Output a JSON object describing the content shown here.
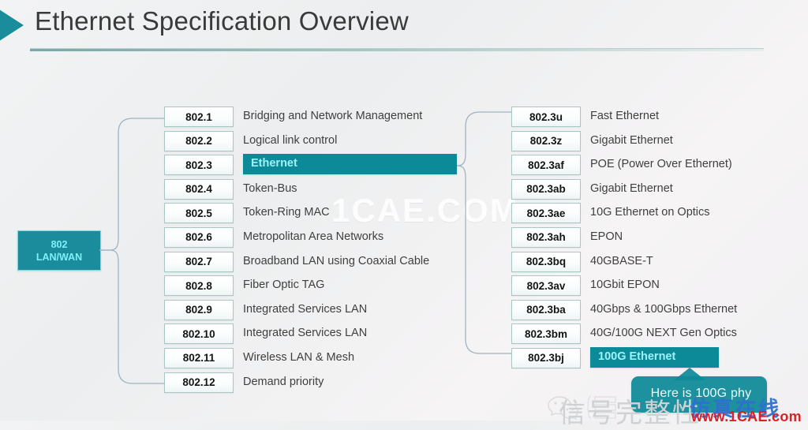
{
  "header": {
    "title": "Ethernet Specification Overview",
    "arrow_icon": "triangle-right-icon"
  },
  "root_node": {
    "line1": "802",
    "line2": "LAN/WAN",
    "color": "#1b8c9b"
  },
  "colors": {
    "accent": "#1b8c9b",
    "highlight_bg": "#0d8a98",
    "highlight_text": "#9ef2fa",
    "box_border": "#a9c6c5",
    "text": "#3f3f3f",
    "callout_bg": "#0e8a98"
  },
  "left_column": [
    {
      "code": "802.1",
      "desc": "Bridging and Network Management",
      "highlight": false
    },
    {
      "code": "802.2",
      "desc": "Logical link control",
      "highlight": false
    },
    {
      "code": "802.3",
      "desc": "Ethernet",
      "highlight": true
    },
    {
      "code": "802.4",
      "desc": "Token-Bus",
      "highlight": false
    },
    {
      "code": "802.5",
      "desc": "Token-Ring MAC",
      "highlight": false
    },
    {
      "code": "802.6",
      "desc": "Metropolitan Area Networks",
      "highlight": false
    },
    {
      "code": "802.7",
      "desc": "Broadband LAN using Coaxial Cable",
      "highlight": false
    },
    {
      "code": "802.8",
      "desc": "Fiber Optic TAG",
      "highlight": false
    },
    {
      "code": "802.9",
      "desc": "Integrated Services LAN",
      "highlight": false
    },
    {
      "code": "802.10",
      "desc": "Integrated Services LAN",
      "highlight": false
    },
    {
      "code": "802.11",
      "desc": "Wireless LAN & Mesh",
      "highlight": false
    },
    {
      "code": "802.12",
      "desc": "Demand priority",
      "highlight": false
    }
  ],
  "right_column": [
    {
      "code": "802.3u",
      "desc": "Fast Ethernet",
      "highlight": false
    },
    {
      "code": "802.3z",
      "desc": "Gigabit Ethernet",
      "highlight": false
    },
    {
      "code": "802.3af",
      "desc": "POE (Power Over Ethernet)",
      "highlight": false
    },
    {
      "code": "802.3ab",
      "desc": "Gigabit Ethernet",
      "highlight": false
    },
    {
      "code": "802.3ae",
      "desc": "10G Ethernet on Optics",
      "highlight": false
    },
    {
      "code": "802.3ah",
      "desc": "EPON",
      "highlight": false
    },
    {
      "code": "802.3bq",
      "desc": "40GBASE-T",
      "highlight": false
    },
    {
      "code": "802.3av",
      "desc": "10Gbit EPON",
      "highlight": false
    },
    {
      "code": "802.3ba",
      "desc": "40Gbps & 100Gbps Ethernet",
      "highlight": false
    },
    {
      "code": "802.3bm",
      "desc": "40G/100G NEXT Gen Optics",
      "highlight": false
    },
    {
      "code": "802.3bj",
      "desc": "100G Ethernet",
      "highlight": true
    }
  ],
  "callout": {
    "text": "Here is 100G phy"
  },
  "watermarks": {
    "center": "1CAE.COM",
    "bottom_cn": "信号完整性",
    "bottom_cn2": "仿真在线",
    "bottom_url": "www.1CAE.com",
    "logo_icon": "wechat-logo-icon",
    "doc_icon": "document-icon"
  }
}
